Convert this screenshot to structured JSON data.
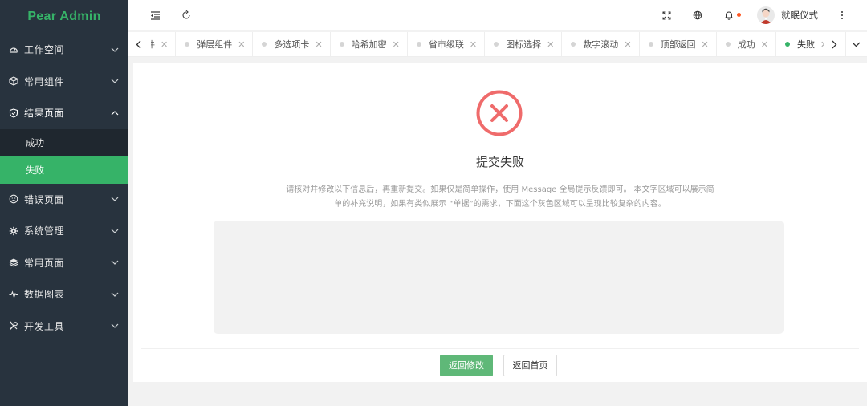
{
  "app": {
    "title": "Pear Admin"
  },
  "sidebar": {
    "items": [
      {
        "icon": "dashboard-icon",
        "label": "工作空间",
        "expanded": false
      },
      {
        "icon": "cube-icon",
        "label": "常用组件",
        "expanded": false
      },
      {
        "icon": "shield-icon",
        "label": "结果页面",
        "expanded": true,
        "children": [
          {
            "label": "成功",
            "active": false
          },
          {
            "label": "失败",
            "active": true
          }
        ]
      },
      {
        "icon": "face-icon",
        "label": "错误页面",
        "expanded": false
      },
      {
        "icon": "gear-icon",
        "label": "系统管理",
        "expanded": false
      },
      {
        "icon": "layers-icon",
        "label": "常用页面",
        "expanded": false
      },
      {
        "icon": "pulse-icon",
        "label": "数据图表",
        "expanded": false
      },
      {
        "icon": "tools-icon",
        "label": "开发工具",
        "expanded": false
      }
    ]
  },
  "header": {
    "icons": [
      "menu-fold-icon",
      "refresh-icon",
      "fullscreen-icon",
      "globe-icon",
      "bell-icon",
      "more-icon"
    ],
    "user_name": "就眠仪式"
  },
  "tabs": {
    "items": [
      {
        "label": "组件",
        "active": false
      },
      {
        "label": "弹层组件",
        "active": false
      },
      {
        "label": "多选项卡",
        "active": false
      },
      {
        "label": "哈希加密",
        "active": false
      },
      {
        "label": "省市级联",
        "active": false
      },
      {
        "label": "图标选择",
        "active": false
      },
      {
        "label": "数字滚动",
        "active": false
      },
      {
        "label": "顶部返回",
        "active": false
      },
      {
        "label": "成功",
        "active": false
      },
      {
        "label": "失败",
        "active": true
      }
    ]
  },
  "result": {
    "status": "error",
    "title": "提交失败",
    "description": "请核对并修改以下信息后，再重新提交。如果仅是简单操作，使用 Message 全局提示反馈即可。 本文字区域可以展示简单的补充说明，如果有类似展示 “单据”的需求，下面这个灰色区域可以呈现比较复杂的内容。",
    "primary_button": "返回修改",
    "secondary_button": "返回首页"
  },
  "colors": {
    "accent": "#36b368",
    "sidebar_bg": "#28333e",
    "error": "#ef6b6b"
  }
}
